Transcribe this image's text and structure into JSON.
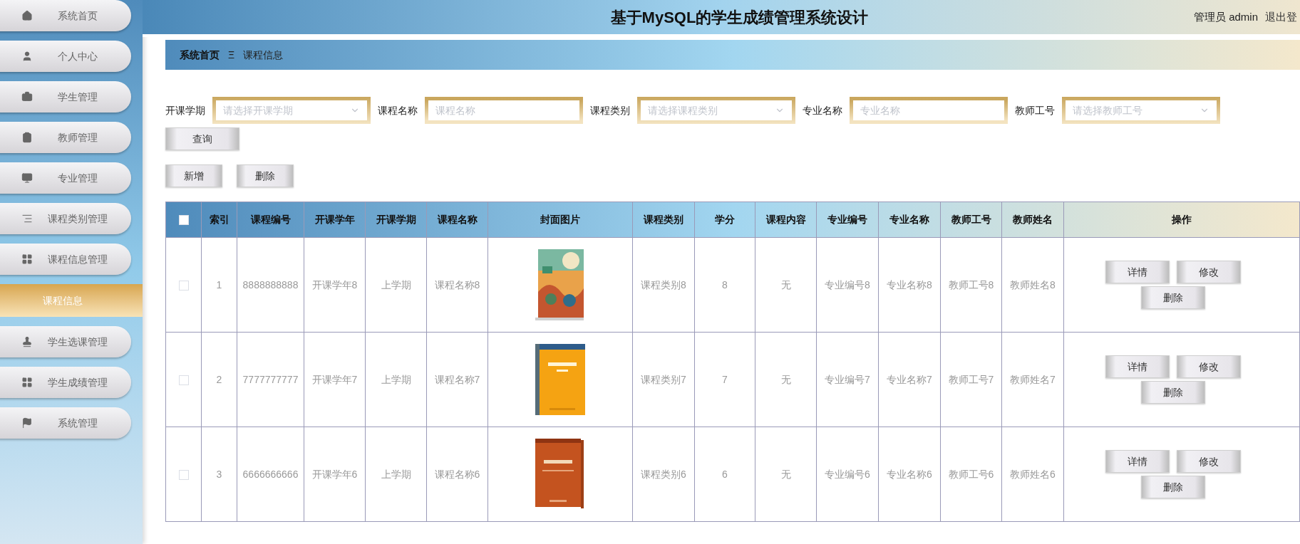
{
  "sidebar": {
    "items": [
      {
        "label": "系统首页",
        "selected": false
      },
      {
        "label": "个人中心",
        "selected": false
      },
      {
        "label": "学生管理",
        "selected": false
      },
      {
        "label": "教师管理",
        "selected": false
      },
      {
        "label": "专业管理",
        "selected": false
      },
      {
        "label": "课程类别管理",
        "selected": false
      },
      {
        "label": "课程信息管理",
        "selected": false,
        "children": [
          {
            "label": "课程信息",
            "selected": true
          }
        ]
      },
      {
        "label": "学生选课管理",
        "selected": false
      },
      {
        "label": "学生成绩管理",
        "selected": false
      },
      {
        "label": "系统管理",
        "selected": false
      }
    ]
  },
  "header": {
    "title": "基于MySQL的学生成绩管理系统设计",
    "user": "管理员 admin",
    "logout": "退出登"
  },
  "breadcrumb": {
    "items": [
      "系统首页",
      "课程信息"
    ],
    "separator": "Ξ"
  },
  "filters": [
    {
      "label": "开课学期",
      "kind": "select",
      "placeholder": "请选择开课学期"
    },
    {
      "label": "课程名称",
      "kind": "input",
      "placeholder": "课程名称"
    },
    {
      "label": "课程类别",
      "kind": "select",
      "placeholder": "请选择课程类别"
    },
    {
      "label": "专业名称",
      "kind": "input",
      "placeholder": "专业名称"
    },
    {
      "label": "教师工号",
      "kind": "select",
      "placeholder": "请选择教师工号"
    }
  ],
  "search_button": "查询",
  "actions": [
    "新增",
    "删除"
  ],
  "table": {
    "select_all_checked": false,
    "columns": [
      "索引",
      "课程编号",
      "开课学年",
      "开课学期",
      "课程名称",
      "封面图片",
      "课程类别",
      "学分",
      "课程内容",
      "专业编号",
      "专业名称",
      "教师工号",
      "教师姓名",
      "操作"
    ],
    "rows": [
      {
        "checked": false,
        "cells": [
          "1",
          "8888888888",
          "开课学年8",
          "上学期",
          "课程名称8",
          null,
          "课程类别8",
          "8",
          "无",
          "专业编号8",
          "专业名称8",
          "教师工号8",
          "教师姓名8"
        ],
        "buttons": [
          "详情",
          "修改",
          "删除"
        ]
      },
      {
        "checked": false,
        "cells": [
          "2",
          "7777777777",
          "开课学年7",
          "上学期",
          "课程名称7",
          null,
          "课程类别7",
          "7",
          "无",
          "专业编号7",
          "专业名称7",
          "教师工号7",
          "教师姓名7"
        ],
        "buttons": [
          "详情",
          "修改",
          "删除"
        ]
      },
      {
        "checked": false,
        "cells": [
          "3",
          "6666666666",
          "开课学年6",
          "上学期",
          "课程名称6",
          null,
          "课程类别6",
          "6",
          "无",
          "专业编号6",
          "专业名称6",
          "教师工号6",
          "教师姓名6"
        ],
        "buttons": [
          "详情",
          "修改",
          "删除"
        ]
      }
    ]
  }
}
